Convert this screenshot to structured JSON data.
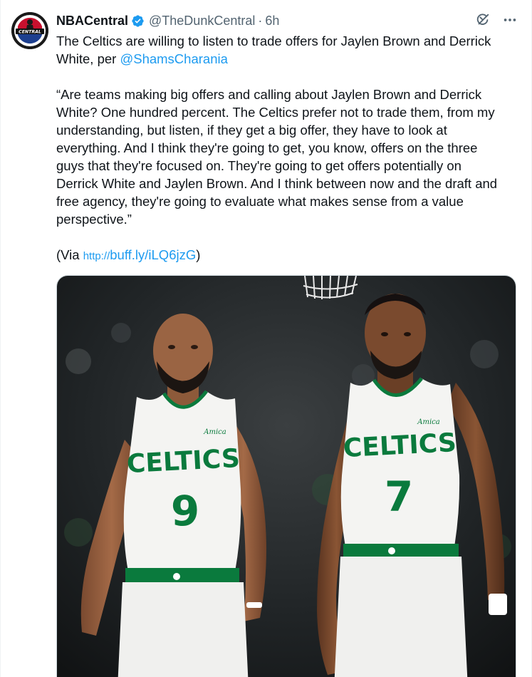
{
  "tweet": {
    "author_name": "NBACentral",
    "handle": "@TheDunkCentral",
    "separator": "·",
    "time": "6h",
    "avatar_text": "CENTRAL",
    "line1_pre": "The Celtics are willing to listen to trade offers for Jaylen Brown and Derrick White, per ",
    "mention": "@ShamsCharania",
    "quote_lines": [
      "“Are teams making big offers and calling about Jaylen Brown and Derrick",
      "White? One hundred percent. The Celtics prefer not to trade them, from my",
      "understanding, but listen, if they get a big offer, they have to look at",
      "everything. And I think they're going to get, you know, offers on the three",
      "guys that they're focused on. They're going to get offers potentially on",
      "Derrick White and Jaylen Brown. And I think between now and the draft and",
      "free agency, they're going to evaluate what makes sense from a value",
      "perspective.”"
    ],
    "via_open": "(Via ",
    "link_proto": "http://",
    "link_text": "buff.ly/iLQ6jzG",
    "via_close": ")"
  },
  "media": {
    "left_player": {
      "team": "CELTICS",
      "number": "9",
      "sponsor": "Amica"
    },
    "right_player": {
      "team": "CELTICS",
      "number": "7",
      "sponsor": "Amica"
    }
  },
  "colors": {
    "link": "#1d9bf0",
    "verified": "#1d9bf0",
    "celtics_green": "#0a7a3d",
    "secondary_text": "#536471"
  },
  "icons": [
    "verified-badge-icon",
    "grok-icon",
    "more-icon"
  ]
}
